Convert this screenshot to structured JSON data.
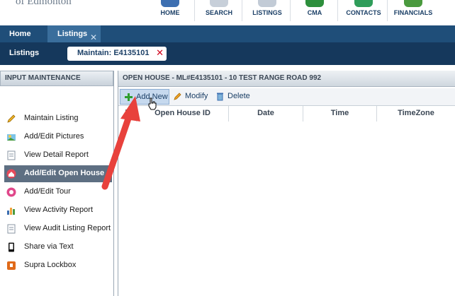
{
  "header": {
    "logo_text": "of Edmonton",
    "nav": [
      {
        "label": "HOME",
        "icon": "home-icon",
        "color": "#3d6fb1"
      },
      {
        "label": "SEARCH",
        "icon": "search-icon",
        "color": "#6c7f98"
      },
      {
        "label": "LISTINGS",
        "icon": "listings-icon",
        "color": "#7a8ca4"
      },
      {
        "label": "CMA",
        "icon": "cma-icon",
        "color": "#2d8f3c"
      },
      {
        "label": "CONTACTS",
        "icon": "contacts-icon",
        "color": "#2f9d5a"
      },
      {
        "label": "FINANCIALS",
        "icon": "financials-icon",
        "color": "#4a9a3e"
      }
    ]
  },
  "tabs": [
    {
      "label": "Home",
      "active": false
    },
    {
      "label": "Listings",
      "active": true
    }
  ],
  "subbar": {
    "label": "Listings",
    "open_item": "Maintain: E4135101"
  },
  "left_panel": {
    "title": "INPUT MAINTENANCE",
    "items": [
      {
        "label": "Maintain Listing",
        "icon": "pencil-icon",
        "selected": false
      },
      {
        "label": "Add/Edit Pictures",
        "icon": "pictures-icon",
        "selected": false
      },
      {
        "label": "View Detail Report",
        "icon": "document-icon",
        "selected": false
      },
      {
        "label": "Add/Edit Open House",
        "icon": "open-house-icon",
        "selected": true
      },
      {
        "label": "Add/Edit Tour",
        "icon": "tour-icon",
        "selected": false
      },
      {
        "label": "View Activity Report",
        "icon": "activity-chart-icon",
        "selected": false
      },
      {
        "label": "View Audit Listing Report",
        "icon": "audit-report-icon",
        "selected": false
      },
      {
        "label": "Share via Text",
        "icon": "phone-icon",
        "selected": false
      },
      {
        "label": "Supra Lockbox",
        "icon": "lockbox-icon",
        "selected": false
      }
    ]
  },
  "right_panel": {
    "title": "OPEN HOUSE - ML#E4135101 - 10 TEST RANGE ROAD 992",
    "toolbar": [
      {
        "label": "Add New",
        "icon": "add-icon"
      },
      {
        "label": "Modify",
        "icon": "modify-icon"
      },
      {
        "label": "Delete",
        "icon": "delete-icon"
      }
    ],
    "columns": [
      "Open House ID",
      "Date",
      "Time",
      "TimeZone"
    ]
  },
  "colors": {
    "tabbar": "#1f4e79",
    "subbar": "#15385c",
    "selected_item": "#5e6f82",
    "annotation_arrow": "#e8413c"
  }
}
